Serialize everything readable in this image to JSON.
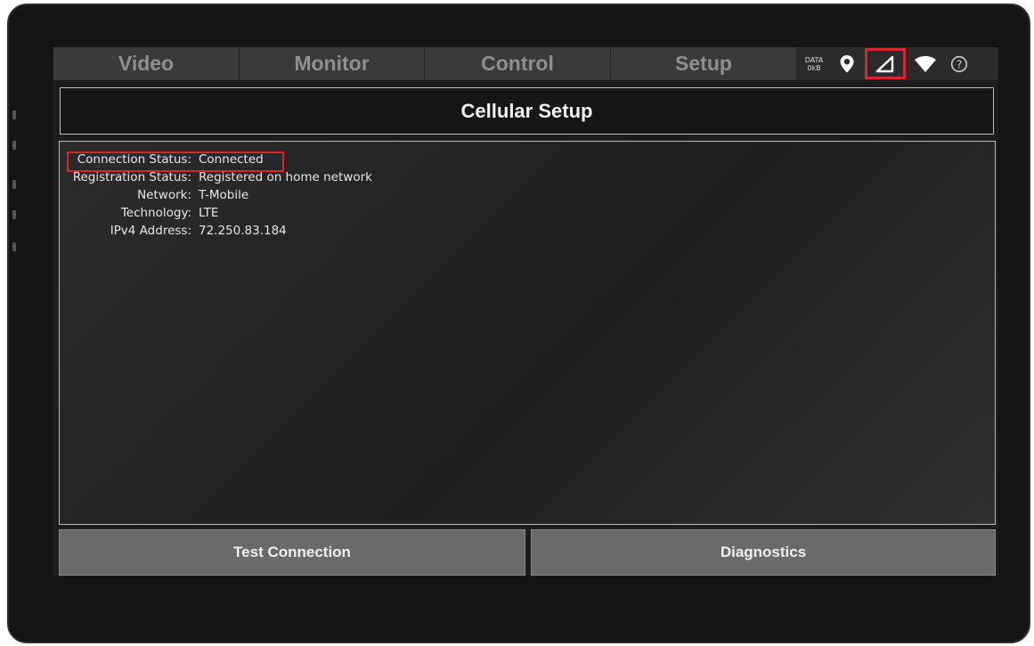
{
  "nav": {
    "tabs": [
      {
        "label": "Video"
      },
      {
        "label": "Monitor"
      },
      {
        "label": "Control"
      },
      {
        "label": "Setup"
      }
    ],
    "data_indicator": {
      "line1": "DATA",
      "line2": "0kB"
    },
    "icons": [
      "location-pin-icon",
      "cellular-signal-icon",
      "wifi-icon",
      "help-icon"
    ]
  },
  "page": {
    "title": "Cellular Setup"
  },
  "status": [
    {
      "label": "Connection Status:",
      "value": "Connected"
    },
    {
      "label": "Registration Status:",
      "value": "Registered on home network"
    },
    {
      "label": "Network:",
      "value": "T-Mobile"
    },
    {
      "label": "Technology:",
      "value": "LTE"
    },
    {
      "label": "IPv4 Address:",
      "value": "72.250.83.184"
    }
  ],
  "buttons": {
    "test_connection": "Test Connection",
    "diagnostics": "Diagnostics"
  },
  "colors": {
    "highlight": "#d8242b",
    "tab_text": "#8f8f8f",
    "button_bg": "#6a6a6a"
  }
}
